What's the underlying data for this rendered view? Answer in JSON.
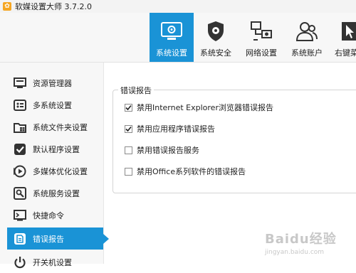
{
  "window": {
    "title": "软媒设置大师 3.7.2.0",
    "app_icon": "app-logo-icon"
  },
  "toolbar": {
    "tabs": [
      {
        "label": "系统设置",
        "icon": "system-settings-icon",
        "active": true
      },
      {
        "label": "系统安全",
        "icon": "shield-gear-icon",
        "active": false
      },
      {
        "label": "网络设置",
        "icon": "network-icon",
        "active": false
      },
      {
        "label": "系统账户",
        "icon": "users-icon",
        "active": false
      },
      {
        "label": "右键菜",
        "icon": "context-menu-icon",
        "active": false
      }
    ]
  },
  "sidebar": {
    "items": [
      {
        "label": "资源管理器",
        "icon": "explorer-icon"
      },
      {
        "label": "多系统设置",
        "icon": "multi-system-icon"
      },
      {
        "label": "系统文件夹设置",
        "icon": "windows-folder-icon"
      },
      {
        "label": "默认程序设置",
        "icon": "default-program-icon"
      },
      {
        "label": "多媒体优化设置",
        "icon": "multimedia-icon"
      },
      {
        "label": "系统服务设置",
        "icon": "service-icon"
      },
      {
        "label": "快捷命令",
        "icon": "shortcut-command-icon"
      },
      {
        "label": "错误报告",
        "icon": "error-report-icon",
        "active": true
      },
      {
        "label": "开关机设置",
        "icon": "power-icon"
      }
    ]
  },
  "main": {
    "group_title": "错误报告",
    "options": [
      {
        "label": "禁用Internet Explorer浏览器错误报告",
        "checked": true
      },
      {
        "label": "禁用应用程序错误报告",
        "checked": true
      },
      {
        "label": "禁用错误报告服务",
        "checked": false
      },
      {
        "label": "禁用Office系列软件的错误报告",
        "checked": false
      }
    ]
  },
  "watermark": {
    "main": "Baidu经验",
    "sub": "jingyan.baidu.com"
  },
  "colors": {
    "accent": "#1a93d6",
    "toolbar_bg": "#f7f7f7",
    "sidebar_bg": "#f7f7f7"
  }
}
